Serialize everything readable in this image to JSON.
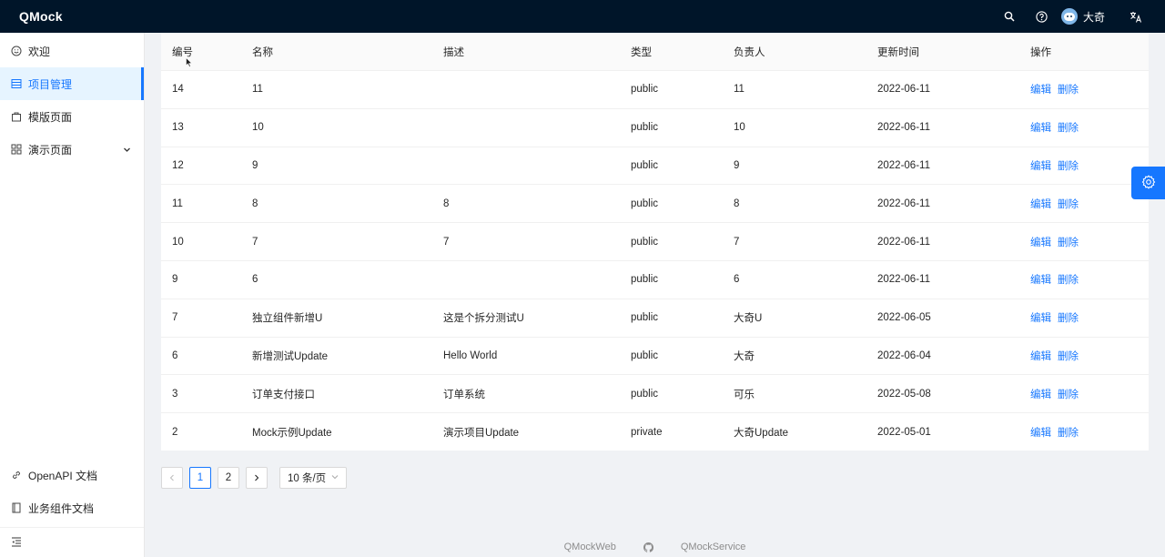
{
  "header": {
    "logo": "QMock",
    "user_name": "大奇"
  },
  "sidebar": {
    "items": [
      {
        "label": "欢迎"
      },
      {
        "label": "项目管理"
      },
      {
        "label": "模版页面"
      },
      {
        "label": "演示页面"
      }
    ],
    "bottom_links": [
      {
        "label": "OpenAPI 文档"
      },
      {
        "label": "业务组件文档"
      }
    ]
  },
  "table": {
    "columns": [
      "编号",
      "名称",
      "描述",
      "类型",
      "负责人",
      "更新时间",
      "操作"
    ],
    "actions": {
      "edit": "编辑",
      "delete": "删除"
    },
    "rows": [
      {
        "id": "14",
        "name": "11",
        "desc": "",
        "type": "public",
        "owner": "11",
        "updated": "2022-06-11"
      },
      {
        "id": "13",
        "name": "10",
        "desc": "",
        "type": "public",
        "owner": "10",
        "updated": "2022-06-11"
      },
      {
        "id": "12",
        "name": "9",
        "desc": "",
        "type": "public",
        "owner": "9",
        "updated": "2022-06-11"
      },
      {
        "id": "11",
        "name": "8",
        "desc": "8",
        "type": "public",
        "owner": "8",
        "updated": "2022-06-11"
      },
      {
        "id": "10",
        "name": "7",
        "desc": "7",
        "type": "public",
        "owner": "7",
        "updated": "2022-06-11"
      },
      {
        "id": "9",
        "name": "6",
        "desc": "",
        "type": "public",
        "owner": "6",
        "updated": "2022-06-11"
      },
      {
        "id": "7",
        "name": "独立组件新增U",
        "desc": "这是个拆分测试U",
        "type": "public",
        "owner": "大奇U",
        "updated": "2022-06-05"
      },
      {
        "id": "6",
        "name": "新增测试Update",
        "desc": "Hello World",
        "type": "public",
        "owner": "大奇",
        "updated": "2022-06-04"
      },
      {
        "id": "3",
        "name": "订单支付接口",
        "desc": "订单系统",
        "type": "public",
        "owner": "可乐",
        "updated": "2022-05-08"
      },
      {
        "id": "2",
        "name": "Mock示例Update",
        "desc": "演示项目Update",
        "type": "private",
        "owner": "大奇Update",
        "updated": "2022-05-01"
      }
    ]
  },
  "pagination": {
    "pages": [
      "1",
      "2"
    ],
    "current": "1",
    "page_size": "10 条/页"
  },
  "footer": {
    "left_link": "QMockWeb",
    "right_link": "QMockService"
  },
  "colors": {
    "primary": "#1677ff",
    "header_bg": "#001529"
  }
}
